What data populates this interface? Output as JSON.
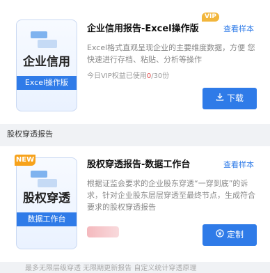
{
  "products": [
    {
      "cover_title": "企业信用",
      "cover_subtitle": "Excel操作版",
      "badge": "VIP",
      "title": "企业信用报告-Excel操作版",
      "sample_link": "查看样本",
      "description": "Excel格式直观呈现企业的主要维度数据，方便 您快速进行存档、粘贴、分析等操作",
      "usage_prefix": "今日VIP权益已使用",
      "usage_used": "0",
      "usage_total": "/30份",
      "button_label": "下载",
      "button_icon": "download-icon"
    },
    {
      "cover_title": "股权穿透",
      "cover_subtitle": "数据工作台",
      "badge": "NEW",
      "title": "股权穿透报告-数据工作台",
      "sample_link": "查看样本",
      "description": "根据证监会要求的企业股东穿透“一穿到底”的诉求，针对企业股东层层穿透至最终节点，生成符合要求的股权穿透报告",
      "button_label": "定制",
      "button_icon": "yuan-icon"
    }
  ],
  "section_label": "股权穿透报告",
  "footer_partial": "最多无限层级穿透  无限期更新报告  自定义统计穿透原理"
}
